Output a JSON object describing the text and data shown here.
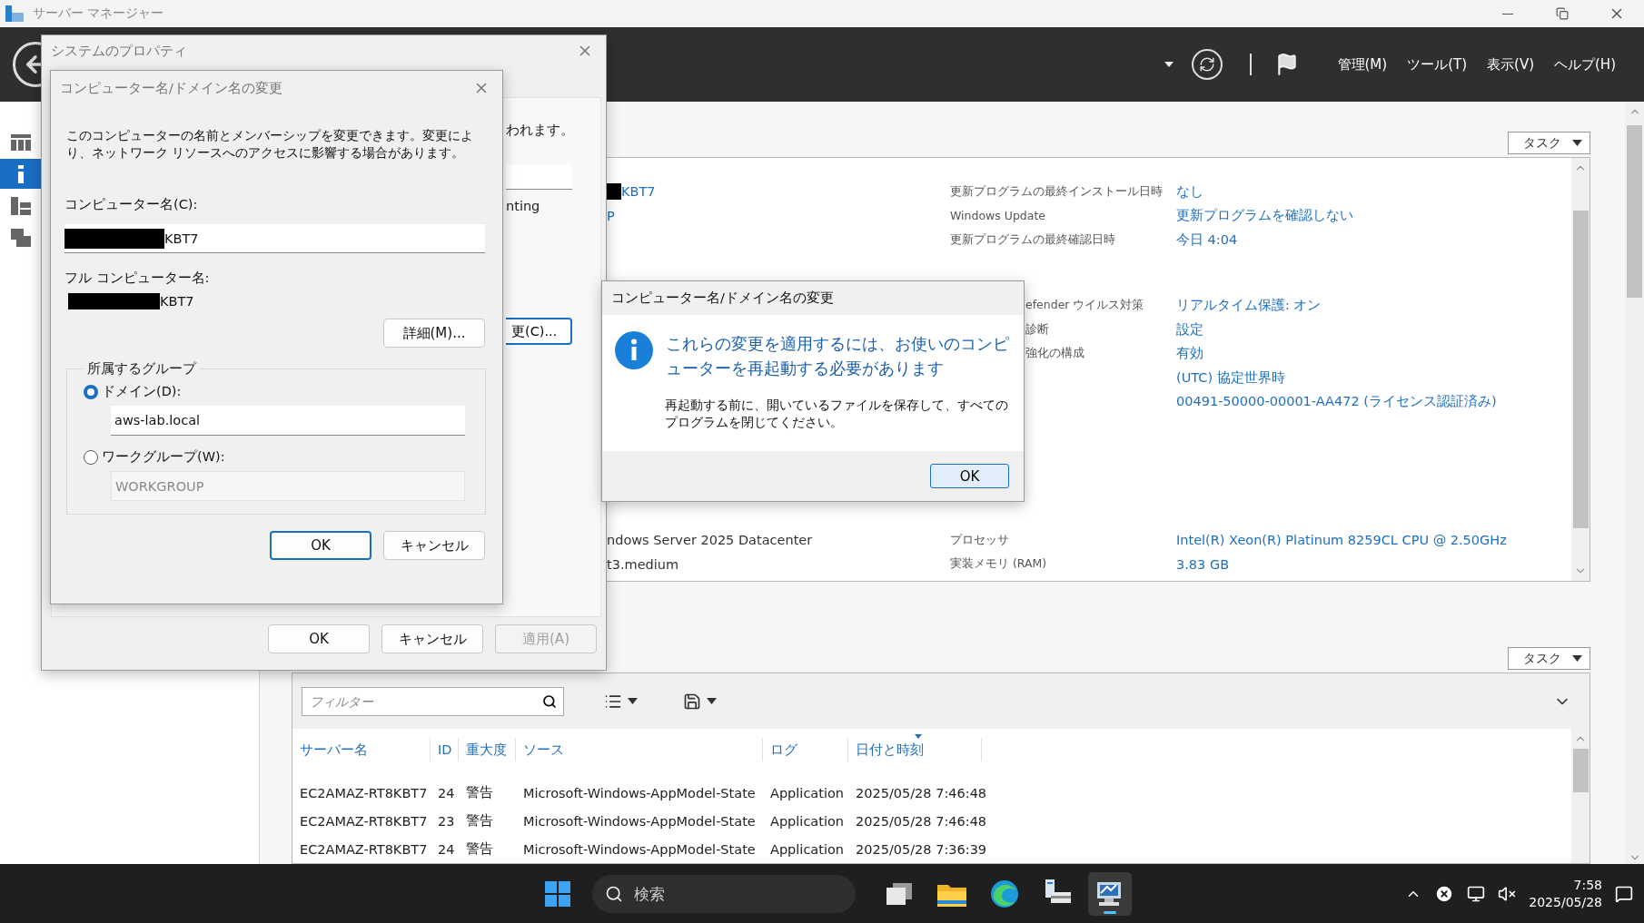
{
  "app": {
    "title": "サーバー マネージャー",
    "menus": [
      "管理(M)",
      "ツール(T)",
      "表示(V)",
      "ヘルプ(H)"
    ],
    "nav": [
      {
        "kind": "dashboard",
        "selected": false
      },
      {
        "kind": "local",
        "selected": true
      },
      {
        "kind": "servers",
        "selected": false
      },
      {
        "kind": "roles",
        "selected": false
      }
    ]
  },
  "properties_panel": {
    "tasks_label": "タスク",
    "groups": [
      {
        "kind": "plain",
        "rows": [
          {
            "left": {
              "text": "KBT7",
              "link": true,
              "redacted": true
            },
            "label": "更新プログラムの最終インストール日時",
            "value": "なし"
          },
          {
            "left": {
              "text": "P",
              "link": true,
              "redacted": false
            },
            "label": "Windows Update",
            "value": "更新プログラムを確認しない"
          },
          {
            "label": "更新プログラムの最終確認日時",
            "value": "今日 4:04"
          }
        ]
      },
      {
        "kind": "covered",
        "rows": [
          {
            "label": "efender ウイルス対策",
            "value": "リアルタイム保護: オン"
          },
          {
            "label": "診断",
            "value": "設定"
          },
          {
            "label": "強化の構成",
            "value": "有効"
          },
          {
            "value": "(UTC) 協定世界時"
          },
          {
            "value": "00491-50000-00001-AA472 (ライセンス認証済み)"
          }
        ]
      },
      {
        "kind": "plain",
        "rows": [
          {
            "left": {
              "text": "ndows Server 2025 Datacenter",
              "link": false,
              "redacted": false
            },
            "label": "プロセッサ",
            "value": "Intel(R) Xeon(R) Platinum 8259CL CPU @ 2.50GHz"
          },
          {
            "left": {
              "text": "t3.medium",
              "link": false,
              "redacted": false
            },
            "label": "実装メモリ (RAM)",
            "value": "3.83 GB"
          }
        ]
      }
    ]
  },
  "events_panel": {
    "tasks_label": "タスク",
    "filter": {
      "placeholder": "フィルター"
    },
    "columns": [
      {
        "label": "サーバー名",
        "sorted": false
      },
      {
        "label": "ID",
        "sorted": false
      },
      {
        "label": "重大度",
        "sorted": false
      },
      {
        "label": "ソース",
        "sorted": false
      },
      {
        "label": "ログ",
        "sorted": false
      },
      {
        "label": "日付と時刻",
        "sorted": true
      }
    ],
    "rows": [
      [
        "EC2AMAZ-RT8KBT7",
        "24",
        "警告",
        "Microsoft-Windows-AppModel-State",
        "Application",
        "2025/05/28 7:46:48"
      ],
      [
        "EC2AMAZ-RT8KBT7",
        "23",
        "警告",
        "Microsoft-Windows-AppModel-State",
        "Application",
        "2025/05/28 7:46:48"
      ],
      [
        "EC2AMAZ-RT8KBT7",
        "24",
        "警告",
        "Microsoft-Windows-AppModel-State",
        "Application",
        "2025/05/28 7:36:39"
      ]
    ]
  },
  "system_properties": {
    "title": "システムのプロパティ",
    "note_fragment": "われます。",
    "field_fragment": "nting",
    "button_fragment": "更(C)...",
    "buttons": [
      {
        "label": "OK",
        "disabled": false,
        "default": false
      },
      {
        "label": "キャンセル",
        "disabled": false,
        "default": false
      },
      {
        "label": "適用(A)",
        "disabled": true,
        "default": false
      }
    ]
  },
  "name_dialog": {
    "title": "コンピューター名/ドメイン名の変更",
    "description": "このコンピューターの名前とメンバーシップを変更できます。変更により、ネットワーク リソースへのアクセスに影響する場合があります。",
    "computer_name_label": "コンピューター名(C):",
    "computer_name": {
      "value": "KBT7",
      "redacted": true
    },
    "full_name_label": "フル コンピューター名:",
    "full_name": {
      "value": "KBT7",
      "redacted": true
    },
    "more_button": "詳細(M)...",
    "group_label": "所属するグループ",
    "membership": [
      {
        "label": "ドメイン(D):",
        "selected": true,
        "value": "aws-lab.local",
        "disabled": false
      },
      {
        "label": "ワークグループ(W):",
        "selected": false,
        "value": "WORKGROUP",
        "disabled": true
      }
    ],
    "buttons": [
      {
        "label": "OK",
        "disabled": false,
        "default": true
      },
      {
        "label": "キャンセル",
        "disabled": false,
        "default": false
      }
    ]
  },
  "message_box": {
    "title": "コンピューター名/ドメイン名の変更",
    "heading": "これらの変更を適用するには、お使いのコンピューターを再起動する必要があります",
    "body": "再起動する前に、開いているファイルを保存して、すべてのプログラムを閉じてください。",
    "button": "OK"
  },
  "taskbar": {
    "search_placeholder": "検索",
    "apps": [
      {
        "kind": "taskview",
        "active": false
      },
      {
        "kind": "explorer",
        "active": false
      },
      {
        "kind": "edge",
        "active": false
      },
      {
        "kind": "server",
        "active": false
      },
      {
        "kind": "manager",
        "active": true
      }
    ],
    "time": "7:58",
    "date": "2025/05/28"
  }
}
